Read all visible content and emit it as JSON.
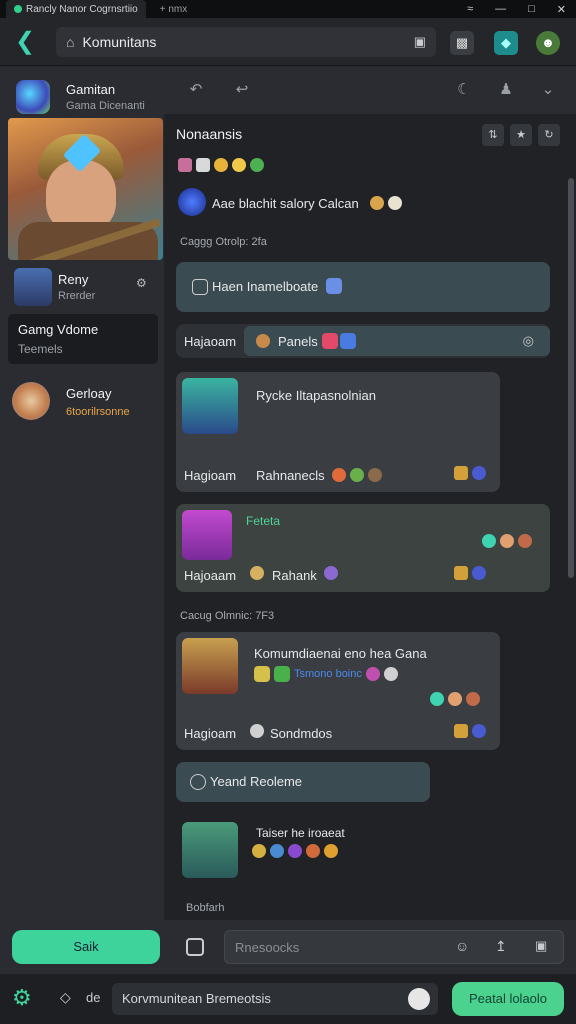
{
  "titlebar": {
    "tab_label": "Rancly Nanor Cogrnsrtiio",
    "new_tab": "+ nmx"
  },
  "addressbar": {
    "url": "Komunitans"
  },
  "sidebar": {
    "app_title": "Gamitan",
    "app_subtitle": "Gama Dicenanti",
    "items": [
      {
        "name": "Reny",
        "subtitle": "Rrerder"
      },
      {
        "name": "Gamg Vdome",
        "subtitle": "Teemels"
      },
      {
        "name": "Gerloay",
        "subtitle": "6toorilrsonne"
      }
    ]
  },
  "main": {
    "section_title": "Nonaansis",
    "intro_text": "Aae blachit salory Calcan",
    "group_label_1": "Caggg Otrolp: 2fa",
    "group_label_2": "Cacug Olmnic: 7F3",
    "bubble_1": "Haen Inamelboate",
    "row_label": "Hajaoam",
    "row_value": "Panels",
    "card_1": {
      "title": "Rycke Iltapasnolnian",
      "label": "Hagioam",
      "value": "Rahnanecls"
    },
    "card_2": {
      "title": "Feteta",
      "label": "Hajoaam",
      "value": "Rahank"
    },
    "card_3": {
      "title": "Komumdiaenai eno hea Gana",
      "link": "Tsmono boinc",
      "label": "Hagioam",
      "value": "Sondmdos"
    },
    "bubble_2": "Yeand Reoleme",
    "card_4_title": "Taiser he iroaeat",
    "footer_label": "Bobfarh"
  },
  "composer": {
    "send_label": "Saik",
    "placeholder": "Rnesoocks"
  },
  "bottombar": {
    "label": "de",
    "input_value": "Korvmunitean Bremeotsis",
    "action_label": "Peatal lolaolo"
  }
}
